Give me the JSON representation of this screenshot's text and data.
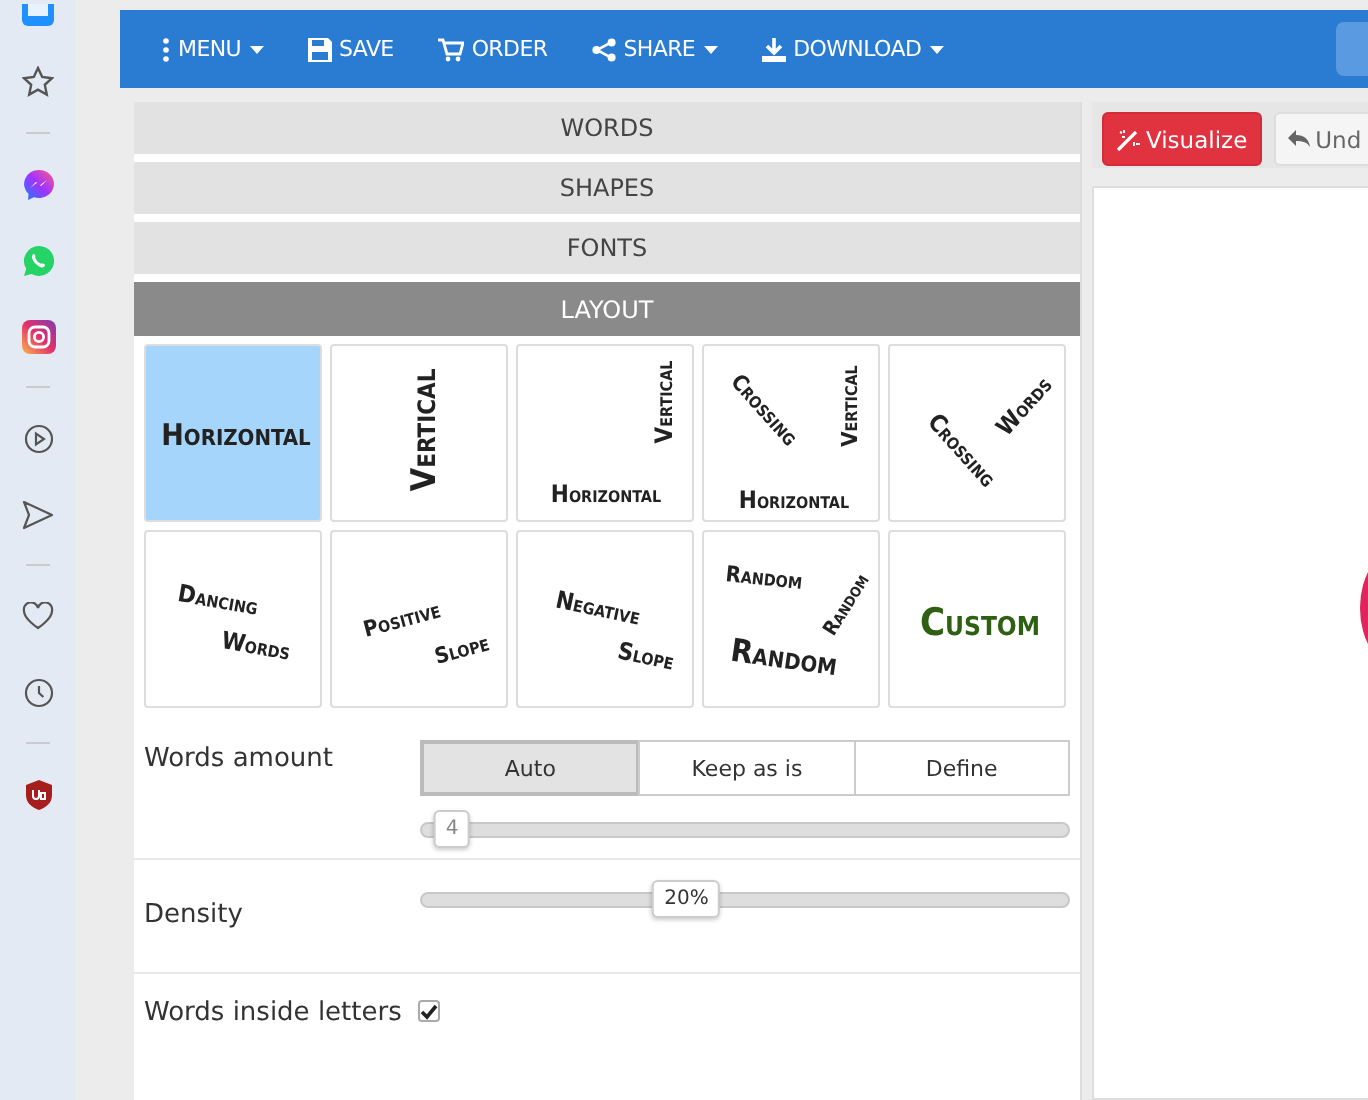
{
  "sidebar": {
    "items": [
      {
        "kind": "app"
      },
      {
        "kind": "star"
      },
      {
        "kind": "divider"
      },
      {
        "kind": "messenger"
      },
      {
        "kind": "whatsapp"
      },
      {
        "kind": "instagram"
      },
      {
        "kind": "divider"
      },
      {
        "kind": "play"
      },
      {
        "kind": "send"
      },
      {
        "kind": "divider"
      },
      {
        "kind": "heart"
      },
      {
        "kind": "clock"
      },
      {
        "kind": "divider"
      },
      {
        "kind": "shield"
      }
    ]
  },
  "toolbar": {
    "items": [
      {
        "label": "MENU",
        "dropdown": true
      },
      {
        "label": "SAVE",
        "dropdown": false
      },
      {
        "label": "ORDER",
        "dropdown": false
      },
      {
        "label": "SHARE",
        "dropdown": true
      },
      {
        "label": "DOWNLOAD",
        "dropdown": true
      }
    ]
  },
  "sections": [
    {
      "label": "WORDS",
      "expanded": false
    },
    {
      "label": "SHAPES",
      "expanded": false
    },
    {
      "label": "FONTS",
      "expanded": false
    },
    {
      "label": "LAYOUT",
      "expanded": true
    }
  ],
  "layouts": [
    {
      "kind": "horizontal",
      "selected": true,
      "words": [
        "Horizontal"
      ]
    },
    {
      "kind": "vertical",
      "selected": false,
      "words": [
        "Vertical"
      ]
    },
    {
      "kind": "horizontal_vertical",
      "selected": false,
      "words": [
        "Vertical",
        "Horizontal"
      ]
    },
    {
      "kind": "crossing_vertical",
      "selected": false,
      "words": [
        "Crossing",
        "Vertical",
        "Horizontal"
      ]
    },
    {
      "kind": "crossing_words",
      "selected": false,
      "words": [
        "Crossing",
        "Words"
      ]
    },
    {
      "kind": "dancing",
      "selected": false,
      "words": [
        "Dancing",
        "Words"
      ]
    },
    {
      "kind": "positive_slope",
      "selected": false,
      "words": [
        "Positive",
        "Slope"
      ]
    },
    {
      "kind": "negative_slope",
      "selected": false,
      "words": [
        "Negative",
        "Slope"
      ]
    },
    {
      "kind": "random",
      "selected": false,
      "words": [
        "Random",
        "Random",
        "Random"
      ]
    },
    {
      "kind": "custom",
      "selected": false,
      "words": [
        "Custom"
      ]
    }
  ],
  "settings": [
    {
      "kind": "segmented_slider",
      "label": "Words amount",
      "options": [
        {
          "label": "Auto",
          "selected": true
        },
        {
          "label": "Keep as is",
          "selected": false
        },
        {
          "label": "Define",
          "selected": false
        }
      ],
      "level": 0,
      "value_label": "4"
    },
    {
      "kind": "slider",
      "label": "Density",
      "level": 0.41,
      "value_label": "20%"
    },
    {
      "kind": "checkbox",
      "label": "Words inside letters",
      "checked": true
    }
  ],
  "preview": {
    "buttons": [
      {
        "kind": "primary",
        "label": "Visualize"
      },
      {
        "kind": "secondary",
        "label": "Und"
      }
    ]
  }
}
